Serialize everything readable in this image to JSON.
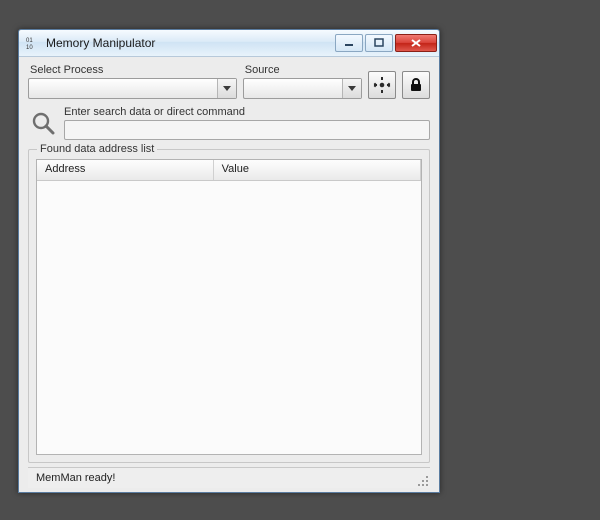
{
  "title": "Memory Manipulator",
  "labels": {
    "select_process": "Select Process",
    "source": "Source",
    "search_hint": "Enter search data or direct command",
    "found_list": "Found data address list"
  },
  "columns": {
    "address": "Address",
    "value": "Value"
  },
  "combos": {
    "process_selected": "",
    "source_selected": ""
  },
  "search_value": "",
  "status": "MemMan ready!",
  "icons": {
    "app": "binary-tweak-icon",
    "minimize": "minimize-icon",
    "maximize": "maximize-icon",
    "close": "close-icon",
    "refresh": "refresh-icon",
    "lock": "lock-icon",
    "search": "search-icon",
    "dropdown": "chevron-down-icon"
  }
}
